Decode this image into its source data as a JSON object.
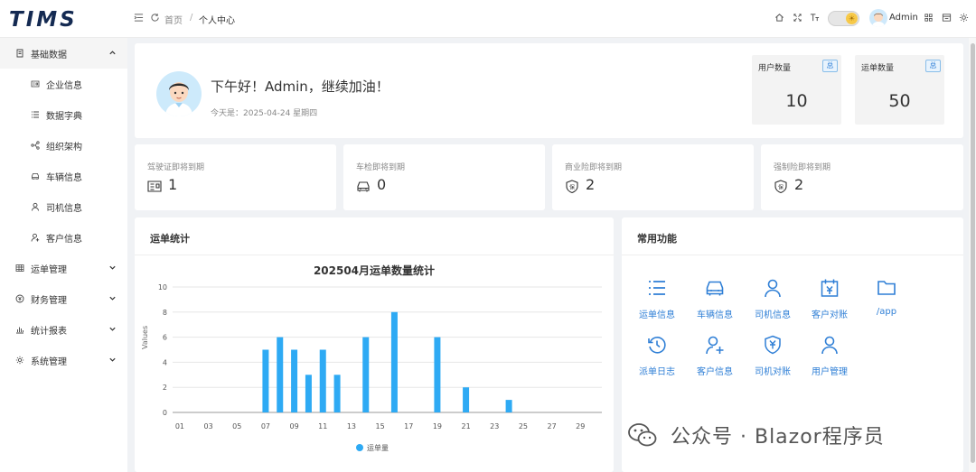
{
  "app": {
    "logo": "TIMS"
  },
  "topbar": {
    "home": "首页",
    "separator": "/",
    "current": "个人中心",
    "user": "Admin",
    "icons": [
      "menu-fold-icon",
      "refresh-icon",
      "home-icon",
      "fullscreen-icon",
      "font-size-icon",
      "theme-toggle",
      "layout-icon",
      "window-icon",
      "gear-icon"
    ]
  },
  "sidebar": {
    "items": [
      {
        "label": "基础数据",
        "icon": "list-icon",
        "open": true
      },
      {
        "label": "企业信息",
        "icon": "id-card-icon"
      },
      {
        "label": "数据字典",
        "icon": "list-icon"
      },
      {
        "label": "组织架构",
        "icon": "org-icon"
      },
      {
        "label": "车辆信息",
        "icon": "car-icon"
      },
      {
        "label": "司机信息",
        "icon": "user-icon"
      },
      {
        "label": "客户信息",
        "icon": "user-add-icon"
      },
      {
        "label": "运单管理",
        "icon": "grid-icon"
      },
      {
        "label": "财务管理",
        "icon": "money-icon"
      },
      {
        "label": "统计报表",
        "icon": "bar-chart-icon"
      },
      {
        "label": "系统管理",
        "icon": "gear-icon"
      }
    ]
  },
  "welcome": {
    "title": "下午好！Admin，继续加油！",
    "date": "今天是：2025-04-24 星期四"
  },
  "stats": [
    {
      "label": "用户数量",
      "badge": "总",
      "value": "10"
    },
    {
      "label": "运单数量",
      "badge": "总",
      "value": "50"
    }
  ],
  "expiry": [
    {
      "label": "驾驶证即将到期",
      "value": "1",
      "icon": "id-card-icon"
    },
    {
      "label": "车检即将到期",
      "value": "0",
      "icon": "car-icon"
    },
    {
      "label": "商业险即将到期",
      "value": "2",
      "icon": "insurance-shield-icon"
    },
    {
      "label": "强制险即将到期",
      "value": "2",
      "icon": "insurance-shield-icon"
    }
  ],
  "shield_glyph": "保",
  "waybill_panel": {
    "title": "运单统计"
  },
  "chart_data": {
    "type": "bar",
    "title": "202504月运单数量统计",
    "ylabel": "Values",
    "ylim": [
      0,
      10
    ],
    "yticks": [
      "0",
      "2",
      "4",
      "6",
      "8",
      "10"
    ],
    "xticks": [
      "01",
      "03",
      "05",
      "07",
      "09",
      "11",
      "13",
      "15",
      "17",
      "19",
      "21",
      "23",
      "25",
      "27",
      "29"
    ],
    "days": 30,
    "series": [
      {
        "name": "运单量",
        "color": "#2eaaf4",
        "values": [
          0,
          0,
          0,
          0,
          0,
          0,
          5,
          6,
          5,
          3,
          5,
          3,
          0,
          6,
          0,
          8,
          0,
          0,
          6,
          0,
          2,
          0,
          0,
          1,
          0,
          0,
          0,
          0,
          0,
          0
        ]
      }
    ],
    "legend": "bottom-center",
    "grid": true
  },
  "functions": {
    "title": "常用功能",
    "items": [
      {
        "label": "运单信息",
        "icon": "list-icon"
      },
      {
        "label": "车辆信息",
        "icon": "car-icon"
      },
      {
        "label": "司机信息",
        "icon": "user-icon"
      },
      {
        "label": "客户对账",
        "icon": "calendar-yen-icon"
      },
      {
        "label": "/app",
        "icon": "folder-icon"
      },
      {
        "label": "派单日志",
        "icon": "history-icon"
      },
      {
        "label": "客户信息",
        "icon": "user-add-icon"
      },
      {
        "label": "司机对账",
        "icon": "shield-yen-icon"
      },
      {
        "label": "用户管理",
        "icon": "user-icon"
      }
    ]
  },
  "watermark": "公众号 · Blazor程序员",
  "colors": {
    "accent": "#2f7fd6",
    "bar": "#2eaaf4",
    "logo": "#142a52"
  }
}
